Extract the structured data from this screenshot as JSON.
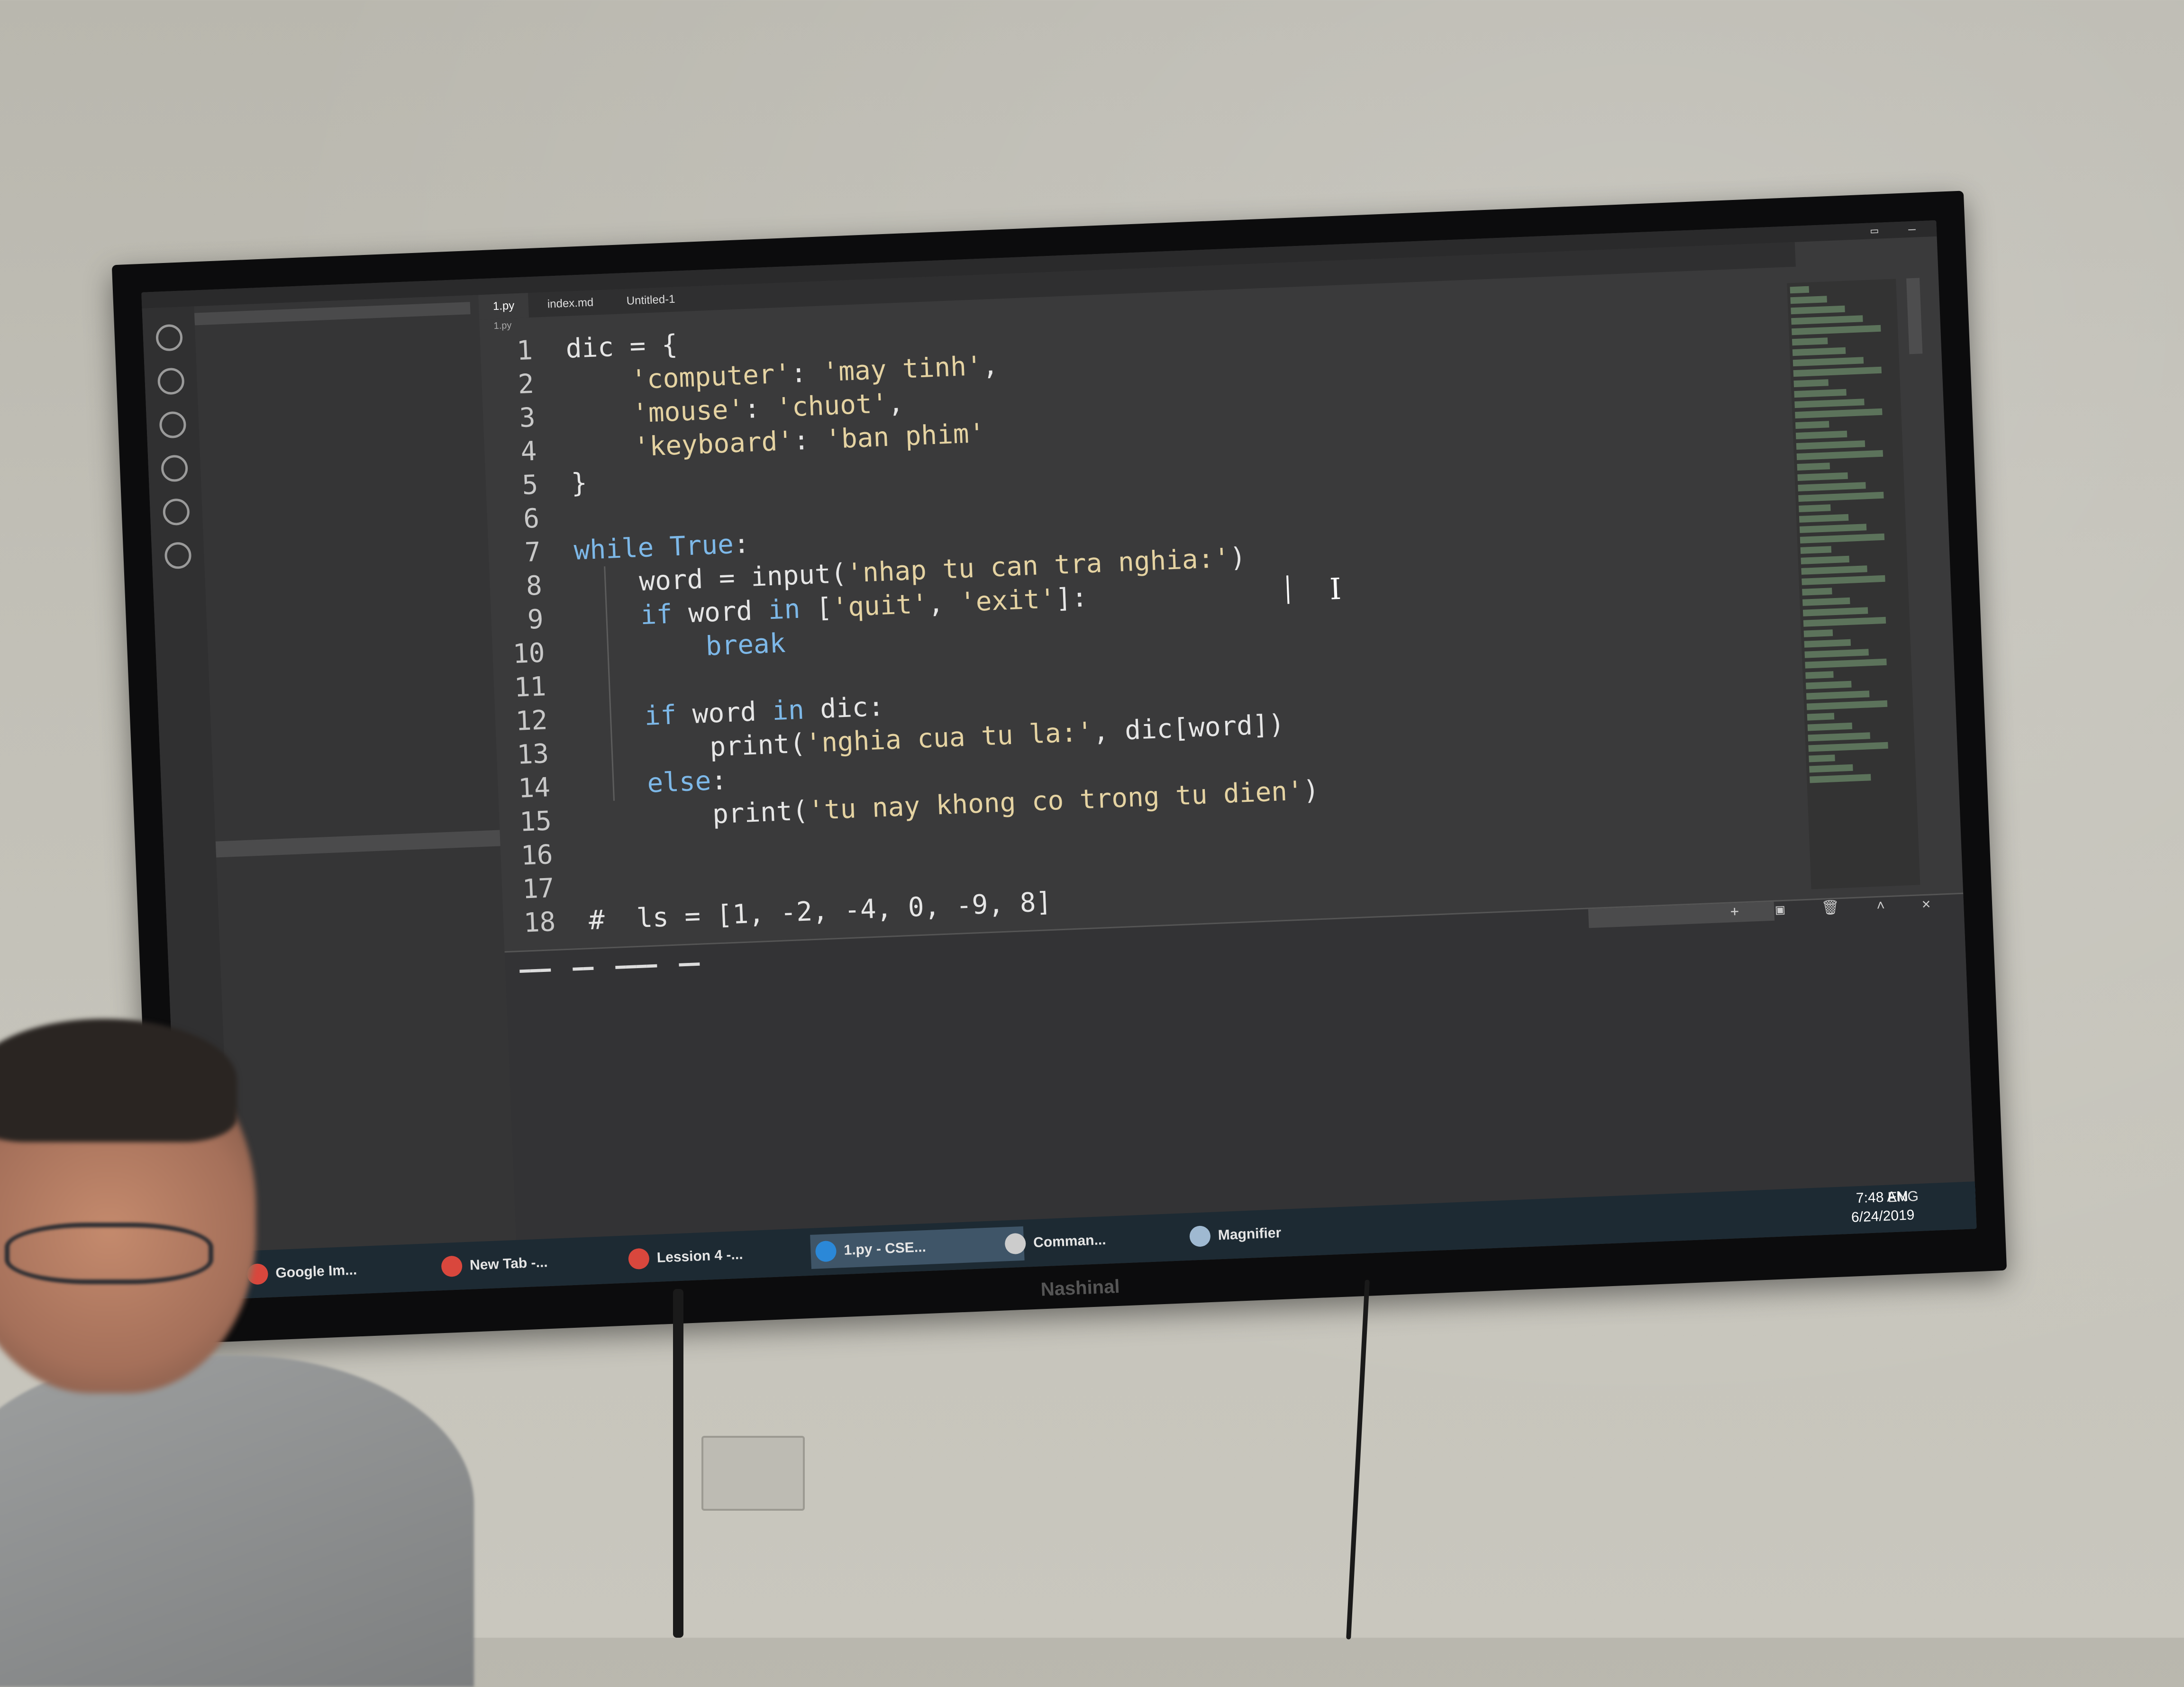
{
  "editor": {
    "tabs": [
      "1.py",
      "index.md",
      "Untitled-1"
    ],
    "active_tab": "1.py",
    "breadcrumb": "1.py",
    "lines": [
      {
        "num": "1",
        "text": "dic = {"
      },
      {
        "num": "2",
        "text": "    'computer': 'may tinh',"
      },
      {
        "num": "3",
        "text": "    'mouse': 'chuot',"
      },
      {
        "num": "4",
        "text": "    'keyboard': 'ban phim'"
      },
      {
        "num": "5",
        "text": "}"
      },
      {
        "num": "6",
        "text": ""
      },
      {
        "num": "7",
        "text": "while True:"
      },
      {
        "num": "8",
        "text": "    word = input('nhap tu can tra nghia:')"
      },
      {
        "num": "9",
        "text": "    if word in ['quit', 'exit']:"
      },
      {
        "num": "10",
        "text": "        break"
      },
      {
        "num": "11",
        "text": ""
      },
      {
        "num": "12",
        "text": "    if word in dic:"
      },
      {
        "num": "13",
        "text": "        print('nghia cua tu la:', dic[word])"
      },
      {
        "num": "14",
        "text": "    else:"
      },
      {
        "num": "15",
        "text": "        print('tu nay khong co trong tu dien')"
      },
      {
        "num": "16",
        "text": ""
      },
      {
        "num": "17",
        "text": ""
      },
      {
        "num": "18",
        "text": "#  ls = [1, -2, -4, 0, -9, 8]"
      }
    ]
  },
  "taskbar": {
    "items": [
      {
        "label": "Google Im...",
        "icon": "chrome-icon",
        "color": "#d9473d"
      },
      {
        "label": "New Tab -...",
        "icon": "chrome-icon",
        "color": "#d9473d"
      },
      {
        "label": "Lession 4 -...",
        "icon": "chrome-icon",
        "color": "#d9473d"
      },
      {
        "label": "1.py - CSE...",
        "icon": "vscode-icon",
        "color": "#2b88d8"
      },
      {
        "label": "Comman...",
        "icon": "terminal-icon",
        "color": "#cccccc"
      },
      {
        "label": "Magnifier",
        "icon": "magnifier-icon",
        "color": "#9fb9d1"
      }
    ],
    "tray_lang": "ENG",
    "time": "7:48 AM",
    "date": "6/24/2019"
  },
  "tv": {
    "brand": "Nashinal"
  },
  "colors": {
    "editor_bg": "#3a3a3b",
    "keyword": "#7db8e8",
    "string": "#e5d3a2",
    "statusbar": "#2c89c7"
  }
}
